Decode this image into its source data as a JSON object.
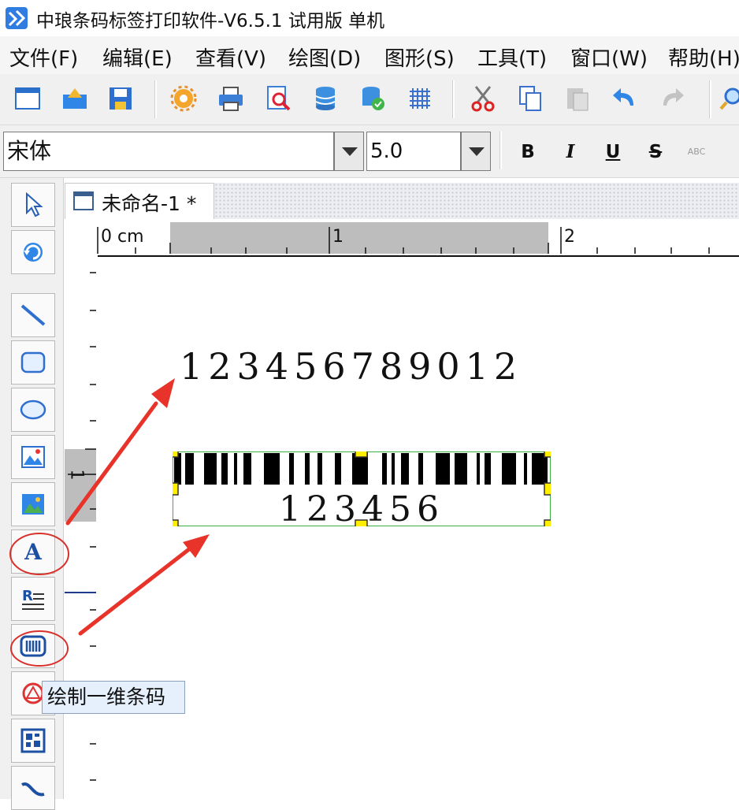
{
  "window": {
    "title": "中琅条码标签打印软件-V6.5.1 试用版 单机"
  },
  "menu": [
    {
      "label": "文件(F)"
    },
    {
      "label": "编辑(E)"
    },
    {
      "label": "查看(V)"
    },
    {
      "label": "绘图(D)"
    },
    {
      "label": "图形(S)"
    },
    {
      "label": "工具(T)"
    },
    {
      "label": "窗口(W)"
    },
    {
      "label": "帮助(H)"
    }
  ],
  "format": {
    "font_name": "宋体",
    "font_size": "5.0",
    "bold": "B",
    "italic": "I",
    "underline": "U",
    "strike": "S",
    "outline": "ABC"
  },
  "document": {
    "tab_label": "未命名-1 *"
  },
  "ruler": {
    "unit_label": "0 cm",
    "h_marks": [
      "1",
      "2"
    ],
    "v_marks": [
      "1"
    ]
  },
  "label": {
    "text_object": "123456789012",
    "barcode_text": "123456"
  },
  "tooltip": {
    "text": "绘制一维条码"
  },
  "colors": {
    "selection_handle": "#ffee00",
    "selection_border": "#3cb043",
    "annotation_arrow": "#e8332a",
    "annotation_circle": "#d9302c"
  }
}
